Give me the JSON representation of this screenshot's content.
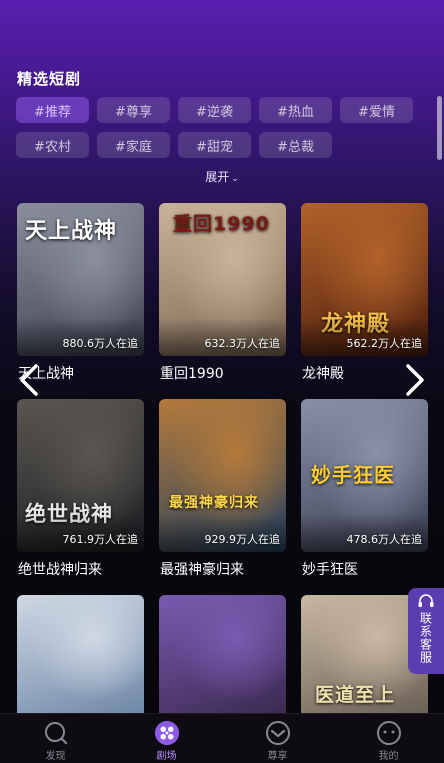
{
  "section": {
    "title": "精选短剧"
  },
  "tags": [
    "#推荐",
    "#尊享",
    "#逆袭",
    "#热血",
    "#爱情",
    "#农村",
    "#家庭",
    "#甜宠",
    "#总裁"
  ],
  "expand_label": "展开",
  "dramas": [
    {
      "title": "天上战神",
      "views": "880.6万人在追",
      "poster_text": "天上战神",
      "colors": [
        "#3b3f4e",
        "#8a8f9e"
      ]
    },
    {
      "title": "重回1990",
      "views": "632.3万人在追",
      "poster_text": "重回1990",
      "colors": [
        "#7a6550",
        "#c9b39a"
      ]
    },
    {
      "title": "龙神殿",
      "views": "562.2万人在追",
      "poster_text": "龙神殿",
      "colors": [
        "#4a1c0c",
        "#b2622a"
      ]
    },
    {
      "title": "绝世战神归来",
      "views": "761.9万人在追",
      "poster_text": "绝世战神",
      "colors": [
        "#1b1d22",
        "#5a5650"
      ]
    },
    {
      "title": "最强神豪归来",
      "views": "929.9万人在追",
      "poster_text": "最强神豪归来",
      "colors": [
        "#244060",
        "#b47a3a"
      ]
    },
    {
      "title": "妙手狂医",
      "views": "478.6万人在追",
      "poster_text": "妙手狂医",
      "colors": [
        "#3a3f52",
        "#8a90a8"
      ]
    },
    {
      "title": "",
      "views": "",
      "poster_text": "",
      "colors": [
        "#6e88a8",
        "#cfd8e4"
      ]
    },
    {
      "title": "",
      "views": "",
      "poster_text": "",
      "colors": [
        "#3c2a52",
        "#7a5ab0"
      ]
    },
    {
      "title": "",
      "views": "",
      "poster_text": "医道至上",
      "colors": [
        "#6a6054",
        "#c9b8a2"
      ]
    }
  ],
  "customer_service": "联系客服",
  "tabbar": [
    {
      "label": "发现",
      "icon": "discover-icon",
      "active": false
    },
    {
      "label": "剧场",
      "icon": "theater-icon",
      "active": true
    },
    {
      "label": "尊享",
      "icon": "vip-icon",
      "active": false
    },
    {
      "label": "我的",
      "icon": "profile-icon",
      "active": false
    }
  ],
  "colors": {
    "accent": "#b58cff",
    "tab_active_bg": "#8c5ae6",
    "service_bg": "#5b3db0"
  }
}
